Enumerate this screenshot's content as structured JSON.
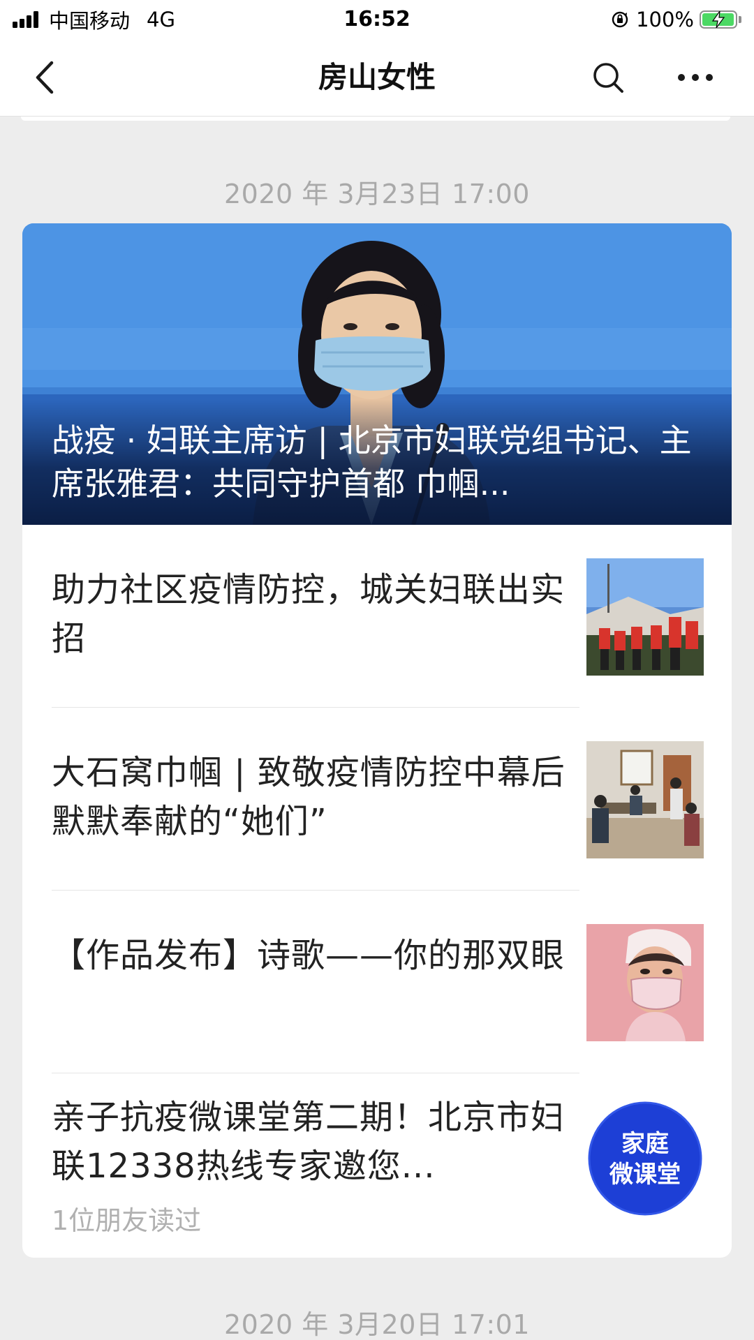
{
  "status_bar": {
    "carrier": "中国移动",
    "network": "4G",
    "time": "16:52",
    "battery_percent": "100%",
    "battery_level": 1.0,
    "icons": [
      "signal-icon",
      "orientation-lock-icon",
      "battery-charging-icon"
    ]
  },
  "nav": {
    "title": "房山女性",
    "icons": [
      "back-icon",
      "search-icon",
      "more-icon"
    ]
  },
  "feed": {
    "date_1": "2020 年 3月23日 17:00",
    "hero": {
      "title": "战疫 · 妇联主席访 | 北京市妇联党组书记、主席张雅君：共同守护首都 巾帼..."
    },
    "articles": [
      {
        "title": "助力社区疫情防控，城关妇联出实招"
      },
      {
        "title": "大石窝巾帼 | 致敬疫情防控中幕后默默奉献的“她们”"
      },
      {
        "title": "【作品发布】诗歌——你的那双眼"
      },
      {
        "title": "亲子抗疫微课堂第二期！北京市妇联12338热线专家邀您...",
        "read_by": "1位朋友读过",
        "thumb_text": [
          "家庭",
          "微课堂"
        ]
      }
    ],
    "date_2": "2020 年 3月20日 17:01"
  },
  "colors": {
    "page_bg": "#ededed",
    "card_bg": "#ffffff",
    "date_text": "#a9a9a9",
    "battery_green": "#4cd964",
    "hero_blue": "#4a93e6",
    "thumb_badge_blue": "#1d3fd6"
  }
}
